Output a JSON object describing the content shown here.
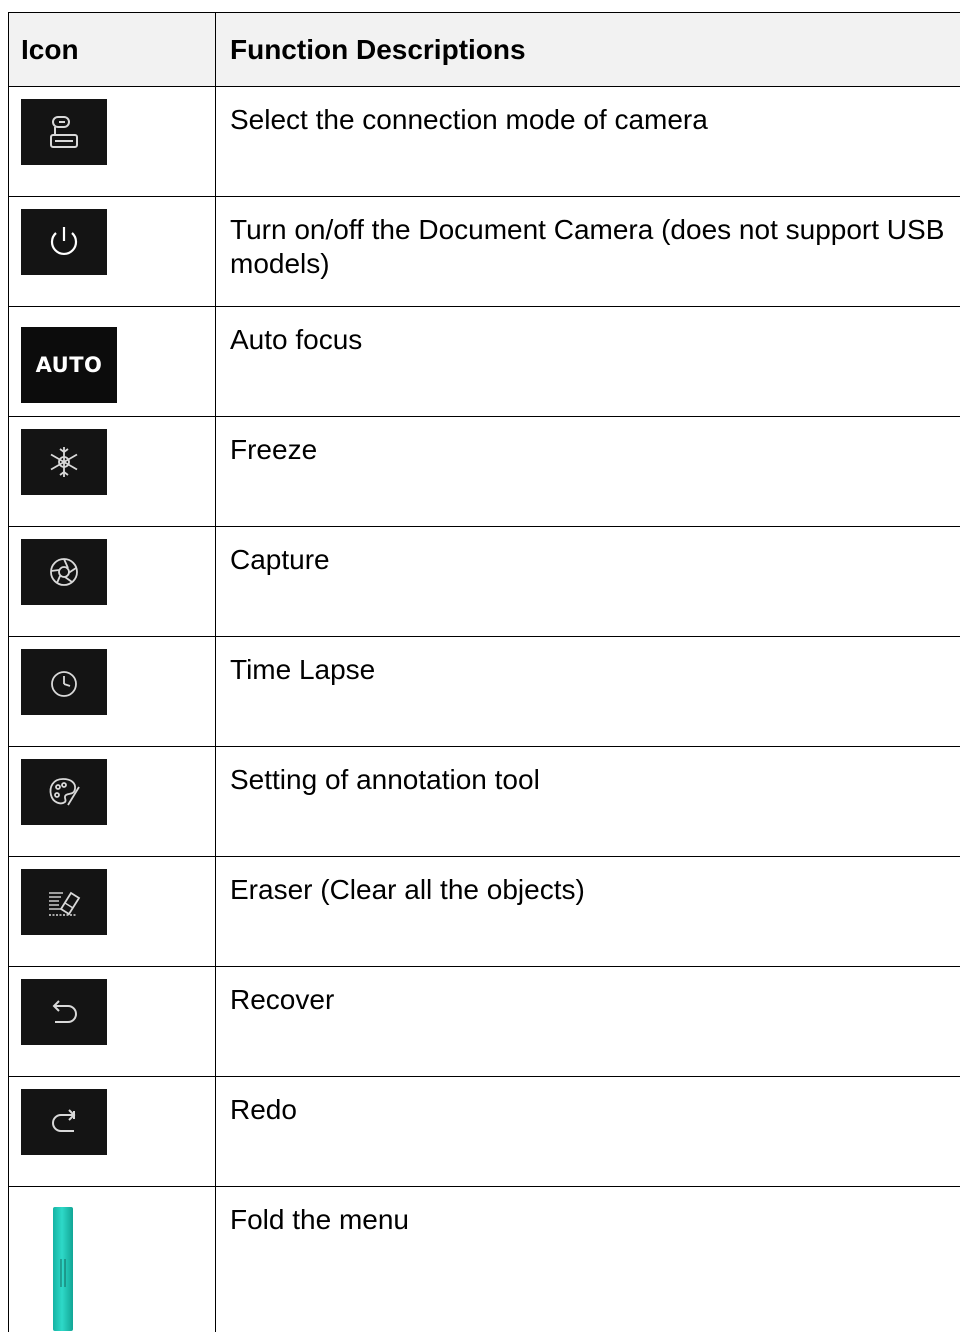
{
  "header": {
    "icon_col": "Icon",
    "desc_col": "Function Descriptions"
  },
  "rows": [
    {
      "icon": "camera-connection-icon",
      "description": "Select the connection mode of camera"
    },
    {
      "icon": "power-icon",
      "description": "Turn on/off the Document Camera (does not support USB models)"
    },
    {
      "icon": "auto-focus-icon",
      "icon_text": "AUTO",
      "description": "Auto focus"
    },
    {
      "icon": "freeze-snowflake-icon",
      "description": "Freeze"
    },
    {
      "icon": "capture-shutter-icon",
      "description": "Capture"
    },
    {
      "icon": "time-lapse-clock-icon",
      "description": "Time Lapse"
    },
    {
      "icon": "annotation-palette-icon",
      "description": "Setting of annotation tool"
    },
    {
      "icon": "eraser-icon",
      "description": "Eraser (Clear all the objects)"
    },
    {
      "icon": "recover-undo-icon",
      "description": "Recover"
    },
    {
      "icon": "redo-icon",
      "description": "Redo"
    },
    {
      "icon": "fold-menu-bar-icon",
      "description": "Fold the menu"
    }
  ],
  "colors": {
    "icon_bg": "#141414",
    "icon_stroke": "#d9d9d9",
    "header_bg": "#f2f2f2",
    "fold_bar": "#2ed9c8"
  }
}
